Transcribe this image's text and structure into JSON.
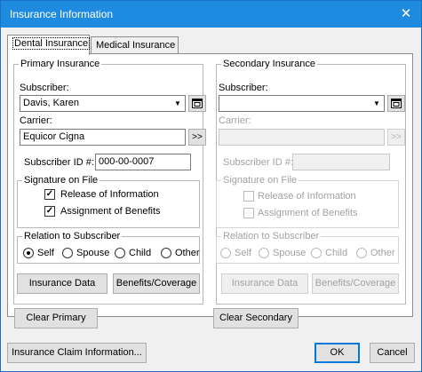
{
  "window": {
    "title": "Insurance Information",
    "close_glyph": "✕"
  },
  "tabs": [
    {
      "label": "Dental Insurance",
      "active": true
    },
    {
      "label": "Medical Insurance",
      "active": false
    }
  ],
  "primary": {
    "group_label": "Primary Insurance",
    "subscriber_label": "Subscriber:",
    "subscriber_value": "Davis, Karen",
    "carrier_label": "Carrier:",
    "carrier_value": "Equicor Cigna",
    "carrier_button": ">>",
    "subscriber_id_label": "Subscriber ID #:",
    "subscriber_id_value": "000-00-0007",
    "signature": {
      "label": "Signature on File",
      "release": {
        "label": "Release of Information",
        "checked": true
      },
      "assignment": {
        "label": "Assignment of Benefits",
        "checked": true
      }
    },
    "relation": {
      "label": "Relation to Subscriber",
      "options": [
        "Self",
        "Spouse",
        "Child",
        "Other"
      ],
      "selected": "Self"
    },
    "insurance_data_button": "Insurance Data",
    "benefits_button": "Benefits/Coverage",
    "clear_button": "Clear Primary"
  },
  "secondary": {
    "group_label": "Secondary Insurance",
    "subscriber_label": "Subscriber:",
    "subscriber_value": "",
    "carrier_label": "Carrier:",
    "carrier_value": "",
    "carrier_button": ">>",
    "subscriber_id_label": "Subscriber ID #:",
    "subscriber_id_value": "",
    "signature": {
      "label": "Signature on File",
      "release": {
        "label": "Release of Information",
        "checked": false
      },
      "assignment": {
        "label": "Assignment of Benefits",
        "checked": false
      }
    },
    "relation": {
      "label": "Relation to Subscriber",
      "options": [
        "Self",
        "Spouse",
        "Child",
        "Other"
      ],
      "selected": ""
    },
    "insurance_data_button": "Insurance Data",
    "benefits_button": "Benefits/Coverage",
    "clear_button": "Clear Secondary"
  },
  "footer": {
    "claim_button": "Insurance Claim Information...",
    "ok_button": "OK",
    "cancel_button": "Cancel"
  },
  "icons": {
    "dropdown": "chevron-down-icon",
    "subscriber_lookup": "window-icon",
    "checkmark": "✓"
  },
  "colors": {
    "titlebar": "#1f8be0",
    "window_border": "#1c6fc2"
  }
}
